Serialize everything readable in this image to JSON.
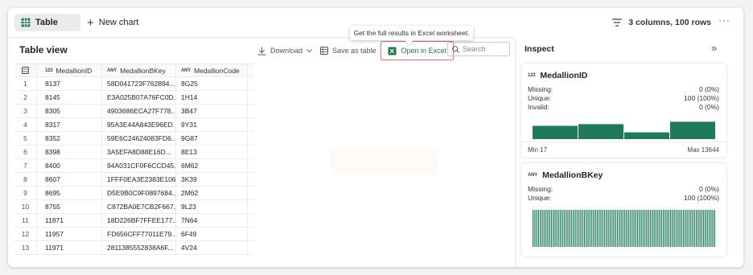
{
  "topbar": {
    "table_tab": "Table",
    "new_chart": "New chart",
    "column_info": "3 columns, 100 rows",
    "more": "···"
  },
  "table_view": {
    "title": "Table view",
    "download": "Download",
    "save_as_table": "Save as table",
    "open_in_excel": "Open in Excel",
    "search_placeholder": "Search",
    "tooltip": "Get the full results in Excel worksheet."
  },
  "grid": {
    "columns": [
      {
        "type": "123",
        "name": "MedallionID"
      },
      {
        "type": "ANY",
        "name": "MedallionBKey"
      },
      {
        "type": "ANY",
        "name": "MedallionCode"
      }
    ],
    "rows": [
      [
        "1",
        "8137",
        "58D041723F762894...",
        "8G25"
      ],
      [
        "2",
        "8145",
        "E3A025B07A76FC0D...",
        "1H14"
      ],
      [
        "3",
        "8305",
        "4903686ECA27F778...",
        "3B47"
      ],
      [
        "4",
        "8317",
        "95A3E44A843E96ED...",
        "9Y31"
      ],
      [
        "5",
        "8352",
        "59E6C24624083FD6...",
        "9G87"
      ],
      [
        "6",
        "8398",
        "3A5EFA8D88E16D...",
        "8E13"
      ],
      [
        "7",
        "8400",
        "94A031CF0F6CCD45...",
        "6M62"
      ],
      [
        "8",
        "8607",
        "1FFF0EA3E2383E106...",
        "3K39"
      ],
      [
        "9",
        "8695",
        "D5E9B0C9F0897684...",
        "2M62"
      ],
      [
        "10",
        "8755",
        "C872BA0E7CB2F667...",
        "9L23"
      ],
      [
        "11",
        "11871",
        "18D226BF7FFEE177...",
        "7N64"
      ],
      [
        "12",
        "11957",
        "FD656CFF77011E79...",
        "6F49"
      ],
      [
        "13",
        "11971",
        "2811385552838A6F...",
        "4V24"
      ]
    ]
  },
  "inspect": {
    "title": "Inspect",
    "cards": [
      {
        "type": "123",
        "name": "MedallionID",
        "stats": [
          {
            "label": "Missing:",
            "value": "0 (0%)"
          },
          {
            "label": "Unique:",
            "value": "100 (100%)"
          },
          {
            "label": "Invalid:",
            "value": "0 (0%)"
          }
        ],
        "min": "Min 17",
        "max": "Max 13644",
        "histogram": [
          0.55,
          0.62,
          0.28,
          0.72
        ]
      },
      {
        "type": "ANY",
        "name": "MedallionBKey",
        "stats": [
          {
            "label": "Missing:",
            "value": "0 (0%)"
          },
          {
            "label": "Unique:",
            "value": "100 (100%)"
          }
        ],
        "bar_count": 100
      }
    ]
  },
  "colors": {
    "accent_green": "#1f7a5a",
    "excel_green": "#1a7a4a",
    "highlight_red": "#e8707a"
  }
}
